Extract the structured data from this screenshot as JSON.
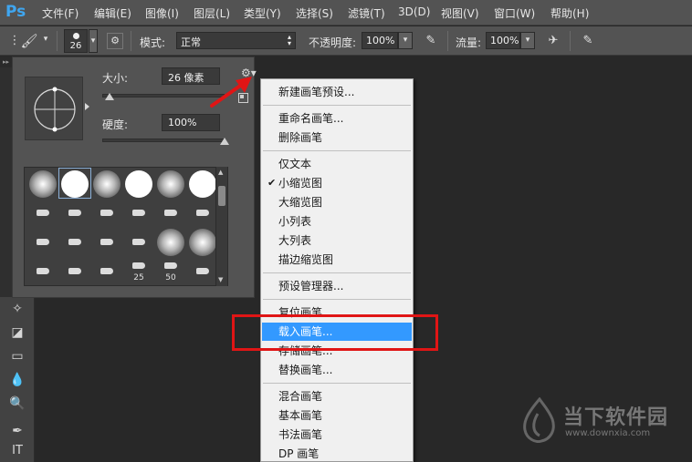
{
  "app": {
    "logo": "Ps",
    "menu": [
      "文件(F)",
      "编辑(E)",
      "图像(I)",
      "图层(L)",
      "类型(Y)",
      "选择(S)",
      "滤镜(T)",
      "3D(D)",
      "视图(V)",
      "窗口(W)",
      "帮助(H)"
    ]
  },
  "options": {
    "brush_size": "26",
    "mode_label": "模式:",
    "mode_value": "正常",
    "opacity_label": "不透明度:",
    "opacity_value": "100%",
    "flow_label": "流量:",
    "flow_value": "100%"
  },
  "brush_panel": {
    "size_label": "大小:",
    "size_value": "26 像素",
    "size_slider": 0.06,
    "hardness_label": "硬度:",
    "hardness_value": "100%",
    "hardness_slider": 1.0,
    "presets": [
      {
        "kind": "soft"
      },
      {
        "kind": "hard"
      },
      {
        "kind": "soft"
      },
      {
        "kind": "hard"
      },
      {
        "kind": "soft"
      },
      {
        "kind": "hard"
      },
      {
        "kind": "tip"
      },
      {
        "kind": "tip"
      },
      {
        "kind": "tip"
      },
      {
        "kind": "tip"
      },
      {
        "kind": "tip"
      },
      {
        "kind": "tip"
      },
      {
        "kind": "tip"
      },
      {
        "kind": "tip"
      },
      {
        "kind": "tip"
      },
      {
        "kind": "tip"
      },
      {
        "kind": "soft"
      },
      {
        "kind": "soft"
      },
      {
        "kind": "tip"
      },
      {
        "kind": "tip"
      },
      {
        "kind": "tip"
      },
      {
        "kind": "tip",
        "num": "25"
      },
      {
        "kind": "tip",
        "num": "50"
      },
      {
        "kind": "tip"
      }
    ],
    "selected_preset": 1
  },
  "context_menu": {
    "items": [
      {
        "label": "新建画笔预设...",
        "checked": false,
        "highlighted": false,
        "sep_after": true
      },
      {
        "label": "重命名画笔...",
        "checked": false,
        "highlighted": false,
        "sep_after": false
      },
      {
        "label": "删除画笔",
        "checked": false,
        "highlighted": false,
        "sep_after": true
      },
      {
        "label": "仅文本",
        "checked": false,
        "highlighted": false,
        "sep_after": false
      },
      {
        "label": "小缩览图",
        "checked": true,
        "highlighted": false,
        "sep_after": false
      },
      {
        "label": "大缩览图",
        "checked": false,
        "highlighted": false,
        "sep_after": false
      },
      {
        "label": "小列表",
        "checked": false,
        "highlighted": false,
        "sep_after": false
      },
      {
        "label": "大列表",
        "checked": false,
        "highlighted": false,
        "sep_after": false
      },
      {
        "label": "描边缩览图",
        "checked": false,
        "highlighted": false,
        "sep_after": true
      },
      {
        "label": "预设管理器...",
        "checked": false,
        "highlighted": false,
        "sep_after": true
      },
      {
        "label": "复位画笔...",
        "checked": false,
        "highlighted": false,
        "sep_after": false
      },
      {
        "label": "载入画笔...",
        "checked": false,
        "highlighted": true,
        "sep_after": false
      },
      {
        "label": "存储画笔...",
        "checked": false,
        "highlighted": false,
        "sep_after": false
      },
      {
        "label": "替换画笔...",
        "checked": false,
        "highlighted": false,
        "sep_after": true
      },
      {
        "label": "混合画笔",
        "checked": false,
        "highlighted": false,
        "sep_after": false
      },
      {
        "label": "基本画笔",
        "checked": false,
        "highlighted": false,
        "sep_after": false
      },
      {
        "label": "书法画笔",
        "checked": false,
        "highlighted": false,
        "sep_after": false
      },
      {
        "label": "DP 画笔",
        "checked": false,
        "highlighted": false,
        "sep_after": false
      }
    ]
  },
  "watermark": {
    "name": "当下软件园",
    "url": "www.downxia.com"
  },
  "colors": {
    "accent": "#3399ff",
    "annotation": "#e01515",
    "ps_blue": "#3fa6f0"
  }
}
